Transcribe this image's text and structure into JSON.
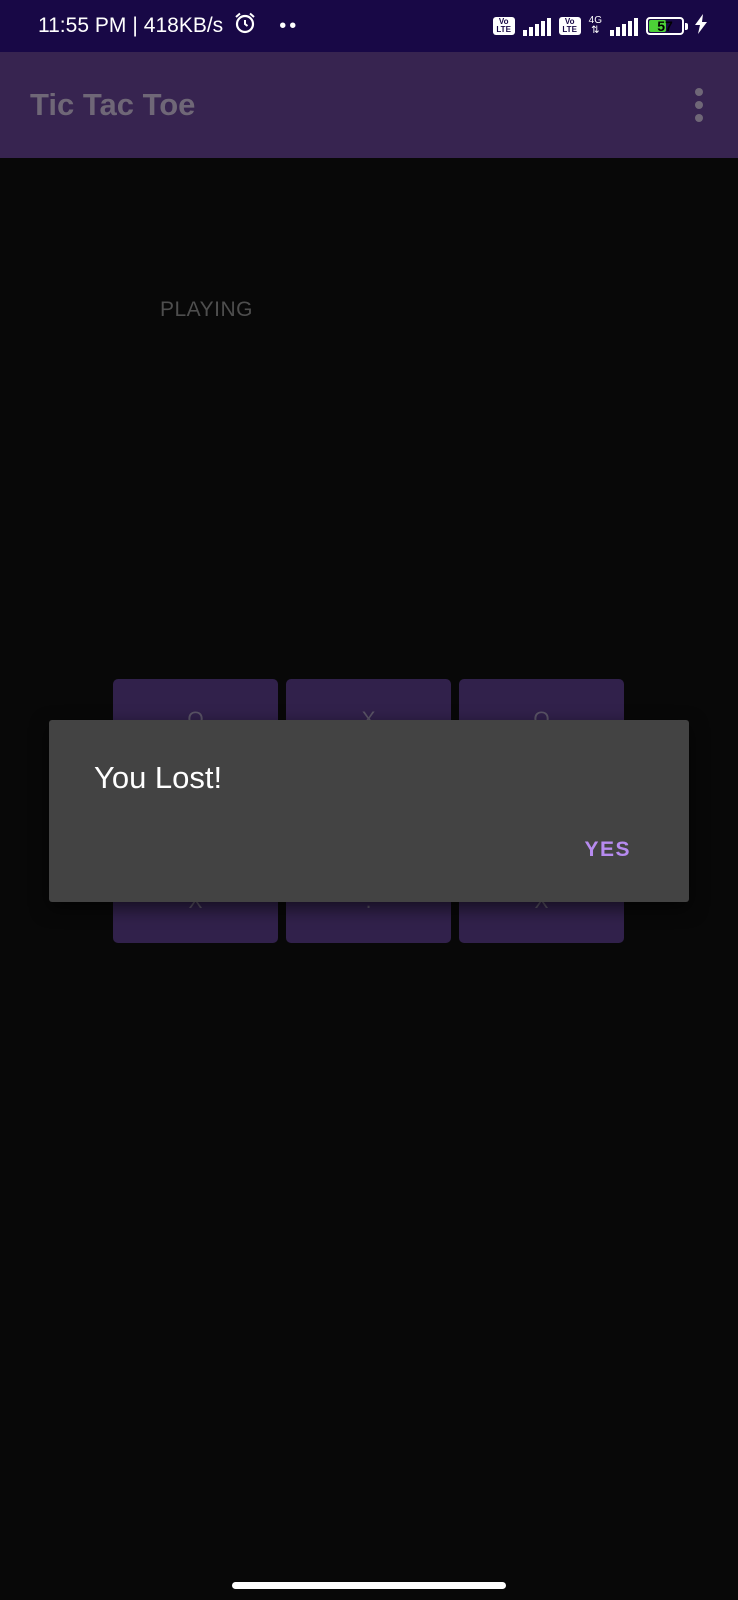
{
  "status_bar": {
    "time": "11:55 PM",
    "separator": "|",
    "network_speed": "418KB/s",
    "alarm_icon": "alarm-clock-icon",
    "more": "••",
    "volte_badge_top": "Vo",
    "volte_badge_bottom": "LTE",
    "network_type": "4G",
    "battery_level": "57",
    "battery_fraction": 0.57,
    "charging_icon": "lightning-bolt-icon"
  },
  "app_bar": {
    "title": "Tic Tac Toe",
    "menu_icon": "more-vertical-icon"
  },
  "game": {
    "status": "PLAYING",
    "board": [
      [
        "O",
        "X",
        "O"
      ],
      [
        "",
        "",
        ""
      ],
      [
        "X",
        ".",
        "X"
      ]
    ]
  },
  "dialog": {
    "title": "You Lost!",
    "confirm_label": "YES"
  },
  "colors": {
    "status_bar_bg": "#180846",
    "app_bar_bg": "#372450",
    "cell_bg": "#31214b",
    "dialog_bg": "#434343",
    "accent": "#b78bf0",
    "battery_fill": "#4cd137"
  }
}
